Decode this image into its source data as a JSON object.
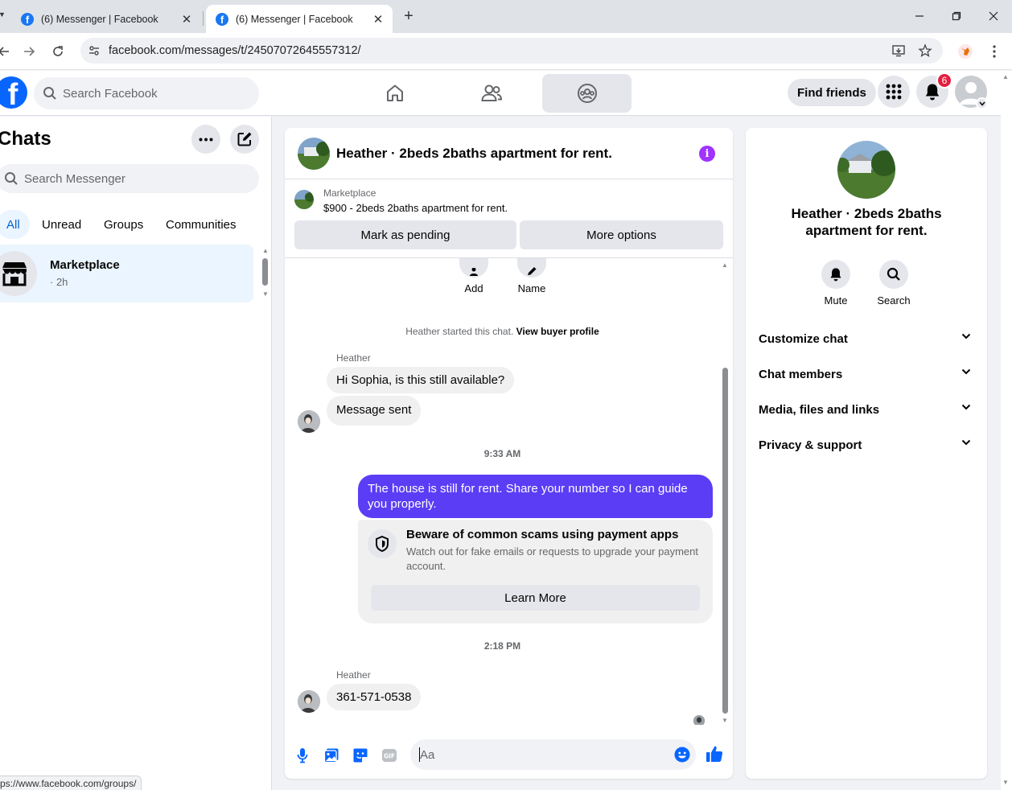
{
  "browser": {
    "tabs": [
      {
        "title": "(6) Messenger | Facebook",
        "active": false
      },
      {
        "title": "(6) Messenger | Facebook",
        "active": true
      }
    ],
    "url": "facebook.com/messages/t/24507072645557312/",
    "status_url": "ps://www.facebook.com/groups/"
  },
  "fb": {
    "logo_letter": "f",
    "search_placeholder": "Search Facebook",
    "find_friends": "Find friends",
    "notification_count": "6"
  },
  "sidebar": {
    "title": "Chats",
    "search_placeholder": "Search Messenger",
    "filters": [
      "All",
      "Unread",
      "Groups",
      "Communities"
    ],
    "conversation": {
      "name": "Marketplace",
      "meta": "· 2h"
    }
  },
  "chat": {
    "title": "Heather · 2beds 2baths apartment for rent.",
    "info_glyph": "i",
    "marketplace_label": "Marketplace",
    "listing": "$900 - 2beds 2baths apartment for rent.",
    "mark_pending": "Mark as pending",
    "more_options": "More options",
    "top_actions": [
      "Add",
      "Name"
    ],
    "system_note": "Heather started this chat.",
    "view_profile": "View buyer profile",
    "sender": "Heather",
    "msg1": "Hi Sophia, is this still available?",
    "msg2": "Message sent",
    "time1": "9:33 AM",
    "outgoing": "The house is still for rent. Share your number so I can guide you properly.",
    "warning_title": "Beware of common scams using payment apps",
    "warning_text": "Watch out for fake emails or requests to upgrade your payment account.",
    "learn_more": "Learn More",
    "time2": "2:18 PM",
    "msg3": "361-571-0538",
    "composer_placeholder": "Aa"
  },
  "right_panel": {
    "title": "Heather · 2beds 2baths apartment for rent.",
    "actions": [
      "Mute",
      "Search"
    ],
    "sections": [
      "Customize chat",
      "Chat members",
      "Media, files and links",
      "Privacy & support"
    ]
  },
  "colors": {
    "fb_blue": "#0866ff",
    "outgoing_bubble": "#5b3df5",
    "info_purple": "#a033ff",
    "badge_red": "#e41e3f"
  }
}
